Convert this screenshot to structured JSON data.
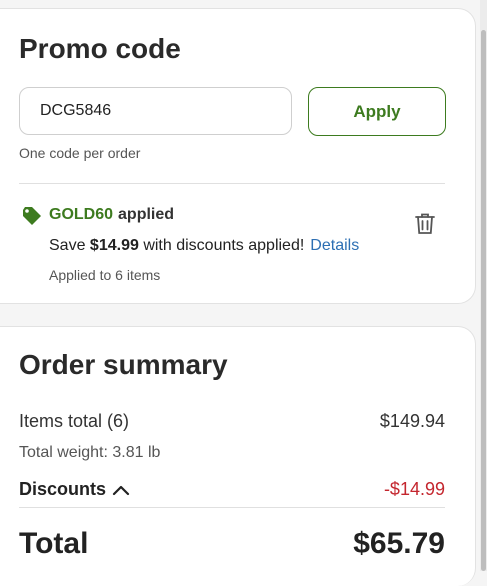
{
  "promo": {
    "title": "Promo code",
    "input_value": "DCG5846",
    "apply_label": "Apply",
    "hint": "One code per order",
    "applied": {
      "code": "GOLD60",
      "status": "applied",
      "save_prefix": "Save",
      "save_amount": "$14.99",
      "save_suffix": "with discounts applied!",
      "details_label": "Details",
      "applied_to": "Applied to 6 items",
      "icon": "tag-icon"
    },
    "remove_icon": "trash-icon"
  },
  "summary": {
    "title": "Order summary",
    "items_label": "Items total (6)",
    "items_value": "$149.94",
    "weight": "Total weight: 3.81 lb",
    "discounts_label": "Discounts",
    "discounts_value": "-$14.99",
    "total_label": "Total",
    "total_value": "$65.79"
  },
  "colors": {
    "brand_green": "#3d7b1f",
    "link_blue": "#2d6fb3",
    "discount_red": "#c4262e"
  }
}
